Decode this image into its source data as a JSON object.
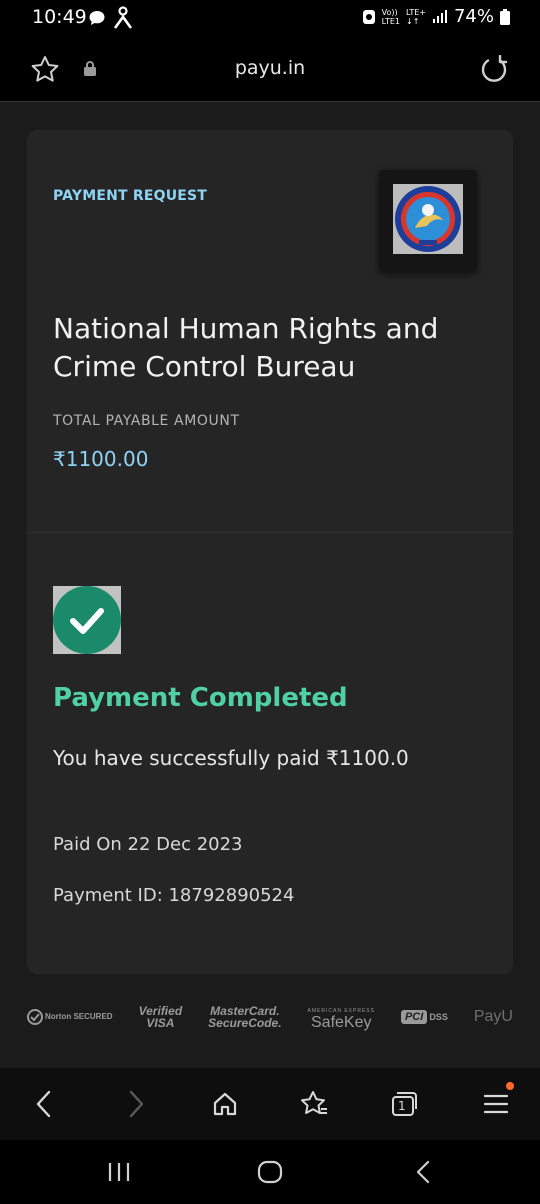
{
  "status_bar": {
    "time": "10:49",
    "network_top": "LTE+",
    "network_bottom": "LTE1",
    "volte": "Vo))",
    "battery": "74%"
  },
  "url_bar": {
    "host": "payu.in"
  },
  "payment": {
    "request_label": "PAYMENT REQUEST",
    "merchant_name": "National Human Rights and Crime Control Bureau",
    "total_label": "TOTAL PAYABLE AMOUNT",
    "total_amount": "₹1100.00",
    "status_title": "Payment Completed",
    "success_message": "You have successfully paid ₹1100.0",
    "paid_on": "Paid On 22 Dec 2023",
    "payment_id": "Payment ID: 18792890524"
  },
  "trust_badges": {
    "norton": "Norton SECURED",
    "visa_top": "Verified",
    "visa_bottom": "VISA",
    "mastercard_top": "MasterCard.",
    "mastercard_bottom": "SecureCode.",
    "amex_top": "AMERICAN EXPRESS",
    "amex_bottom": "SafeKey",
    "pci": "PCI",
    "dss": "DSS",
    "payu": "PayU"
  },
  "toolbar": {
    "tabs_count": "1"
  },
  "colors": {
    "accent_blue": "#8fd3f4",
    "success_green": "#4fd1a5",
    "check_green": "#1b8a6b",
    "notification": "#ff6a2b"
  }
}
